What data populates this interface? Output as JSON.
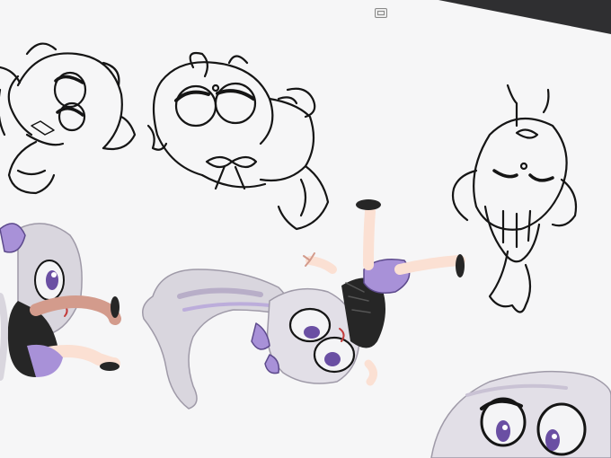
{
  "canvas": {
    "background": "#f6f6f7",
    "line_color": "#151515",
    "hair_color": "#d9d6de",
    "hair_shadow": "#b8aec8",
    "accent_purple": "#a891d8",
    "skin": "#fbe0d3",
    "outfit_dark": "#262626"
  },
  "toolbar": {
    "icon": "view-toggle-icon"
  }
}
